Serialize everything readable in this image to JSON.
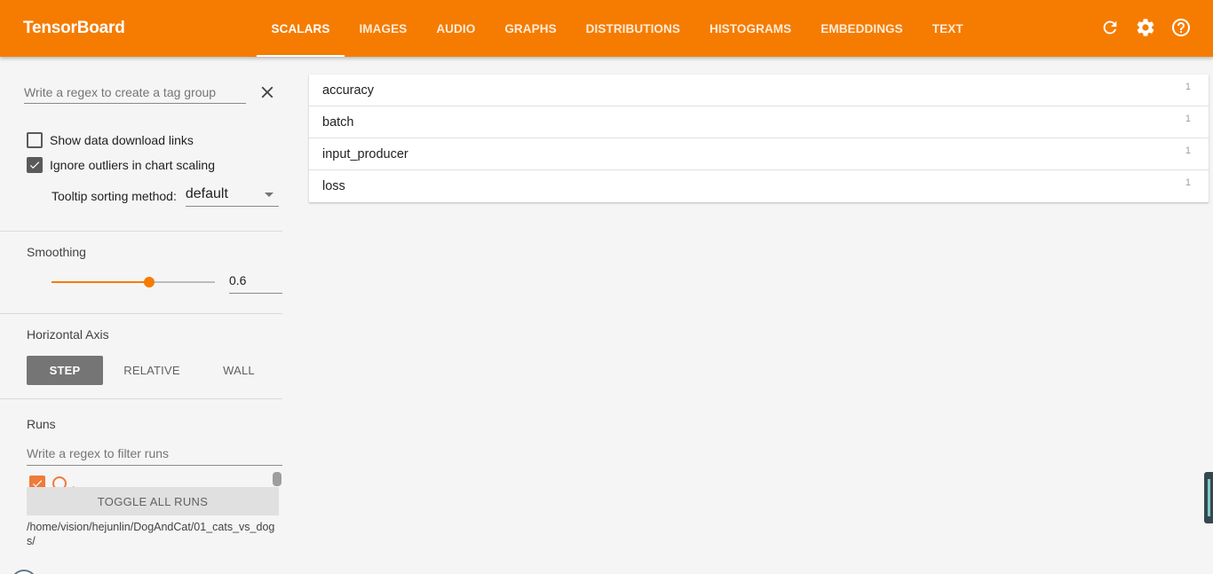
{
  "app": {
    "title": "TensorBoard"
  },
  "nav": {
    "tabs": [
      {
        "label": "SCALARS",
        "active": true
      },
      {
        "label": "IMAGES",
        "active": false
      },
      {
        "label": "AUDIO",
        "active": false
      },
      {
        "label": "GRAPHS",
        "active": false
      },
      {
        "label": "DISTRIBUTIONS",
        "active": false
      },
      {
        "label": "HISTOGRAMS",
        "active": false
      },
      {
        "label": "EMBEDDINGS",
        "active": false
      },
      {
        "label": "TEXT",
        "active": false
      }
    ],
    "icons": [
      "refresh-icon",
      "settings-icon",
      "help-icon"
    ]
  },
  "sidebar": {
    "tag_regex": {
      "placeholder": "Write a regex to create a tag group",
      "value": ""
    },
    "show_download_links": {
      "label": "Show data download links",
      "checked": false
    },
    "ignore_outliers": {
      "label": "Ignore outliers in chart scaling",
      "checked": true
    },
    "tooltip_sort": {
      "label": "Tooltip sorting method:",
      "value": "default"
    },
    "smoothing": {
      "title": "Smoothing",
      "value": "0.6",
      "fraction": 0.6
    },
    "horizontal_axis": {
      "title": "Horizontal Axis",
      "options": [
        {
          "label": "STEP",
          "active": true
        },
        {
          "label": "RELATIVE",
          "active": false
        },
        {
          "label": "WALL",
          "active": false
        }
      ]
    },
    "runs": {
      "title": "Runs",
      "filter_placeholder": "Write a regex to filter runs",
      "run_label": ".",
      "toggle_label": "TOGGLE ALL RUNS",
      "logdir": "/home/vision/hejunlin/DogAndCat/01_cats_vs_dogs/"
    }
  },
  "main": {
    "tags": [
      {
        "name": "accuracy",
        "count": "1"
      },
      {
        "name": "batch",
        "count": "1"
      },
      {
        "name": "input_producer",
        "count": "1"
      },
      {
        "name": "loss",
        "count": "1"
      }
    ]
  },
  "colors": {
    "accent": "#f57c00",
    "run_color": "#f07a3a"
  }
}
